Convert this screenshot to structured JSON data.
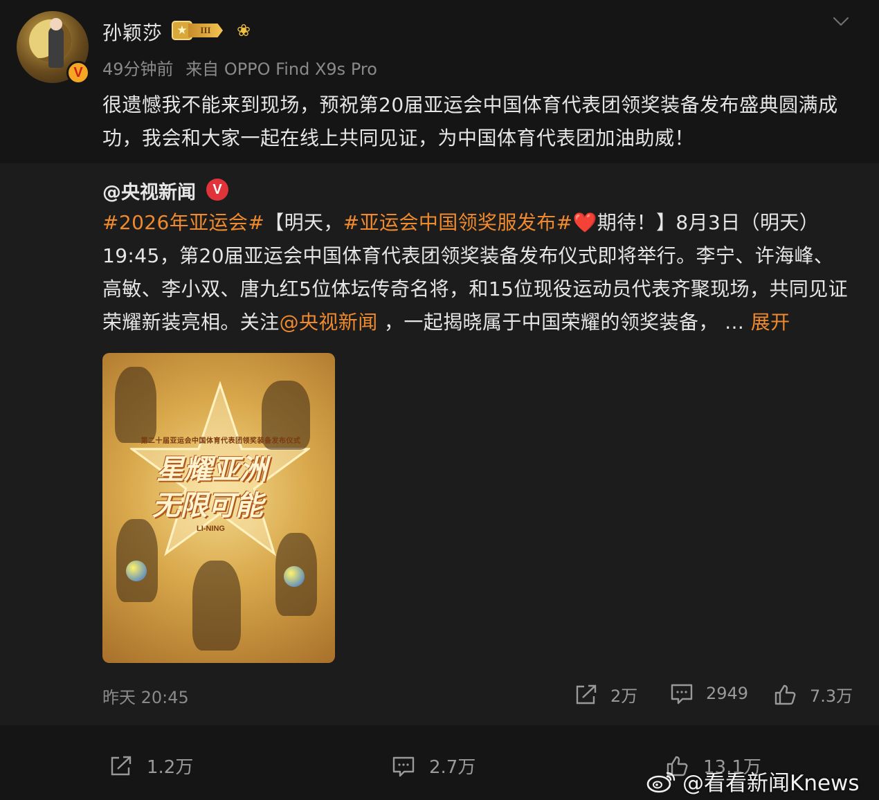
{
  "post": {
    "author": "孙颖莎",
    "level_badge": "III",
    "verified_mark": "V",
    "time": "49分钟前",
    "source": "来自 OPPO Find X9s Pro",
    "text": "很遗憾我不能来到现场，预祝第20届亚运会中国体育代表团领奖装备发布盛典圆满成功，我会和大家一起在线上共同见证，为中国体育代表团加油助威！"
  },
  "repost": {
    "author": "@央视新闻",
    "verified_mark": "V",
    "hashtag1": "#2026年亚运会#",
    "seg1": "【明天，",
    "hashtag2": "#亚运会中国领奖服发布#",
    "heart": "❤️",
    "seg2": "期待！】8月3日（明天）19:45，第20届亚运会中国体育代表团领奖装备发布仪式即将举行。李宁、许海峰、高敏、李小双、唐九红5位体坛传奇名将，和15位现役运动员代表齐聚现场，共同见证荣耀新装亮相。关注",
    "mention": "@央视新闻",
    "seg3": " ，一起揭晓属于中国荣耀的领奖装备，  … ",
    "expand": "展开",
    "image": {
      "banner": "第二十届亚运会中国体育代表团领奖装备发布仪式",
      "title_line1": "星耀亚洲",
      "title_line2": "无限可能",
      "brand": "LI-NING"
    },
    "time": "昨天 20:45",
    "reposts": "2万",
    "comments": "2949",
    "likes": "7.3万"
  },
  "actions": {
    "reposts": "1.2万",
    "comments": "2.7万",
    "likes": "13.1万"
  },
  "watermark": "@看看新闻Knews",
  "icons": {
    "chevron": "chevron-down-icon",
    "flower": "flower-icon",
    "repost": "repost-icon",
    "comment": "comment-icon",
    "like": "thumbs-up-icon",
    "weibo": "weibo-logo-icon"
  },
  "colors": {
    "background": "#151515",
    "card": "#1c1c1c",
    "accent_orange": "#f08a2e",
    "muted": "#8a8a8a",
    "verified_red": "#e0343a",
    "verified_gold": "#f6a623"
  }
}
